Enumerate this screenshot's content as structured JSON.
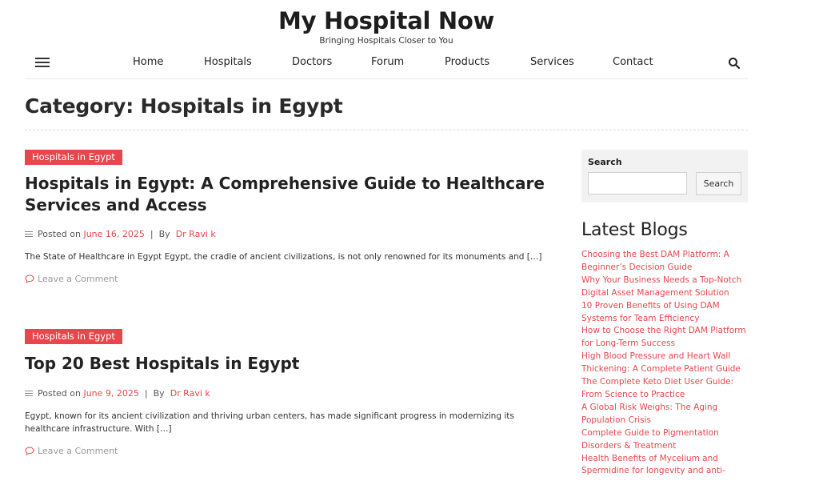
{
  "site": {
    "title": "My Hospital Now",
    "tagline": "Bringing Hospitals Closer to You"
  },
  "nav": {
    "items": [
      "Home",
      "Hospitals",
      "Doctors",
      "Forum",
      "Products",
      "Services",
      "Contact"
    ]
  },
  "category_heading": "Category: Hospitals in Egypt",
  "posts": [
    {
      "category": "Hospitals in Egypt",
      "title": "Hospitals in Egypt: A Comprehensive Guide to Healthcare Services and Access",
      "posted_on_label": "Posted on",
      "date": "June 16, 2025",
      "separator": "|",
      "by_label": "By",
      "author": "Dr Ravi k",
      "excerpt": "The State of Healthcare in Egypt Egypt, the cradle of ancient civilizations, is not only renowned for its monuments and […]",
      "comment_label": "Leave a Comment"
    },
    {
      "category": "Hospitals in Egypt",
      "title": "Top 20 Best Hospitals in Egypt",
      "posted_on_label": "Posted on",
      "date": "June 9, 2025",
      "separator": "|",
      "by_label": "By",
      "author": "Dr Ravi k",
      "excerpt": "Egypt, known for its ancient civilization and thriving urban centers, has made significant progress in modernizing its healthcare infrastructure. With […]",
      "comment_label": "Leave a Comment"
    }
  ],
  "sidebar": {
    "search_label": "Search",
    "search_value": "",
    "search_button": "Search",
    "latest_title": "Latest Blogs",
    "latest_items": [
      "Choosing the Best DAM Platform: A Beginner’s Decision Guide",
      "Why Your Business Needs a Top-Notch Digital Asset Management Solution",
      "10 Proven Benefits of Using DAM Systems for Team Efficiency",
      "How to Choose the Right DAM Platform for Long-Term Success",
      "High Blood Pressure and Heart Wall Thickening: A Complete Patient Guide",
      "The Complete Keto Diet User Guide: From Science to Practice",
      "A Global Risk Weighs: The Aging Population Crisis",
      "Complete Guide to Pigmentation Disorders & Treatment",
      "Health Benefits of Mycelium and Spermidine for longevity and anti-"
    ]
  },
  "colors": {
    "accent": "#e8464d",
    "text": "#222222",
    "muted": "#999999",
    "sidebar_bg": "#f2f2f2"
  },
  "icons": {
    "menu": "hamburger-menu-icon",
    "search": "search-icon",
    "meta": "list-lines-icon",
    "comment": "comment-bubble-icon"
  }
}
